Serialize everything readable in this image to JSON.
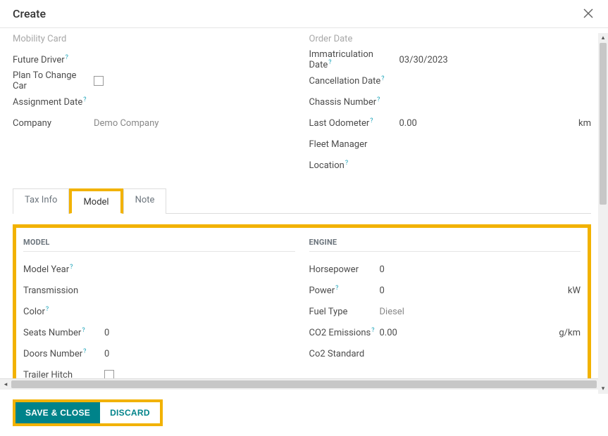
{
  "header": {
    "title": "Create"
  },
  "left": {
    "mobility_card_label": "Mobility Card",
    "future_driver_label": "Future Driver",
    "plan_to_change_car_label": "Plan To Change Car",
    "assignment_date_label": "Assignment Date",
    "company_label": "Company",
    "company_value": "Demo Company"
  },
  "right": {
    "order_date_label": "Order Date",
    "immatriculation_date_label": "Immatriculation Date",
    "immatriculation_date_value": "03/30/2023",
    "cancellation_date_label": "Cancellation Date",
    "chassis_number_label": "Chassis Number",
    "last_odometer_label": "Last Odometer",
    "last_odometer_value": "0.00",
    "last_odometer_unit": "km",
    "fleet_manager_label": "Fleet Manager",
    "location_label": "Location"
  },
  "tabs": {
    "tax_info": "Tax Info",
    "model": "Model",
    "note": "Note"
  },
  "model_section": {
    "title": "MODEL",
    "model_year_label": "Model Year",
    "transmission_label": "Transmission",
    "color_label": "Color",
    "seats_number_label": "Seats Number",
    "seats_number_value": "0",
    "doors_number_label": "Doors Number",
    "doors_number_value": "0",
    "trailer_hitch_label": "Trailer Hitch"
  },
  "engine_section": {
    "title": "ENGINE",
    "horsepower_label": "Horsepower",
    "horsepower_value": "0",
    "power_label": "Power",
    "power_value": "0",
    "power_unit": "kW",
    "fuel_type_label": "Fuel Type",
    "fuel_type_value": "Diesel",
    "co2_emissions_label": "CO2 Emissions",
    "co2_emissions_value": "0.00",
    "co2_emissions_unit": "g/km",
    "co2_standard_label": "Co2 Standard"
  },
  "footer": {
    "save_close": "Save & Close",
    "discard": "Discard"
  }
}
